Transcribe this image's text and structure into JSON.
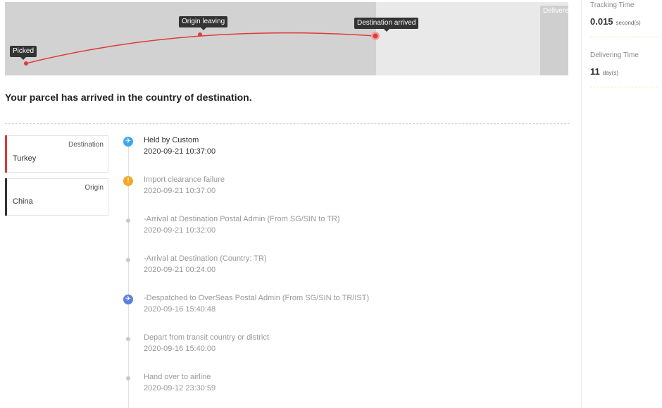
{
  "route": {
    "stops": [
      {
        "label": "Picked",
        "state": "done"
      },
      {
        "label": "Origin leaving",
        "state": "done"
      },
      {
        "label": "Destination arrived",
        "state": "current"
      },
      {
        "label": "Delivere",
        "state": "future"
      }
    ],
    "line_color": "#e03a3a"
  },
  "status_message": "Your parcel has arrived in the country of destination.",
  "parties": [
    {
      "label": "Destination",
      "value": "Turkey",
      "color": "#d9383a"
    },
    {
      "label": "Origin",
      "value": "China",
      "color": "#333333"
    }
  ],
  "events": [
    {
      "title": "Held by Custom",
      "time": "2020-09-21 10:37:00",
      "icon": "plane-landing-icon",
      "icon_color": "#3fa7e8",
      "current": true
    },
    {
      "title": "Import clearance failure",
      "time": "2020-09-21 10:37:00",
      "icon": "exclamation-icon",
      "icon_color": "#f5a623"
    },
    {
      "title": "-Arrival at Destination Postal Admin (From SG/SIN to TR)",
      "time": "2020-09-21 10:32:00",
      "icon": "dot"
    },
    {
      "title": "-Arrival at Destination (Country: TR)",
      "time": "2020-09-21 00:24:00",
      "icon": "dot"
    },
    {
      "title": "-Despatched to OverSeas Postal Admin (From SG/SIN to TR/IST)",
      "time": "2020-09-16 15:40:48",
      "icon": "plane-departure-icon",
      "icon_color": "#5b7fe0"
    },
    {
      "title": "Depart from transit country or district",
      "time": "2020-09-16 15:40:00",
      "icon": "dot"
    },
    {
      "title": "Hand over to airline",
      "time": "2020-09-12 23:30:59",
      "icon": "dot"
    }
  ],
  "stats": {
    "tracking": {
      "label": "Tracking Time",
      "value": "0.015",
      "unit": "second(s)"
    },
    "delivering": {
      "label": "Delivering Time",
      "value": "11",
      "unit": "day(s)"
    }
  }
}
